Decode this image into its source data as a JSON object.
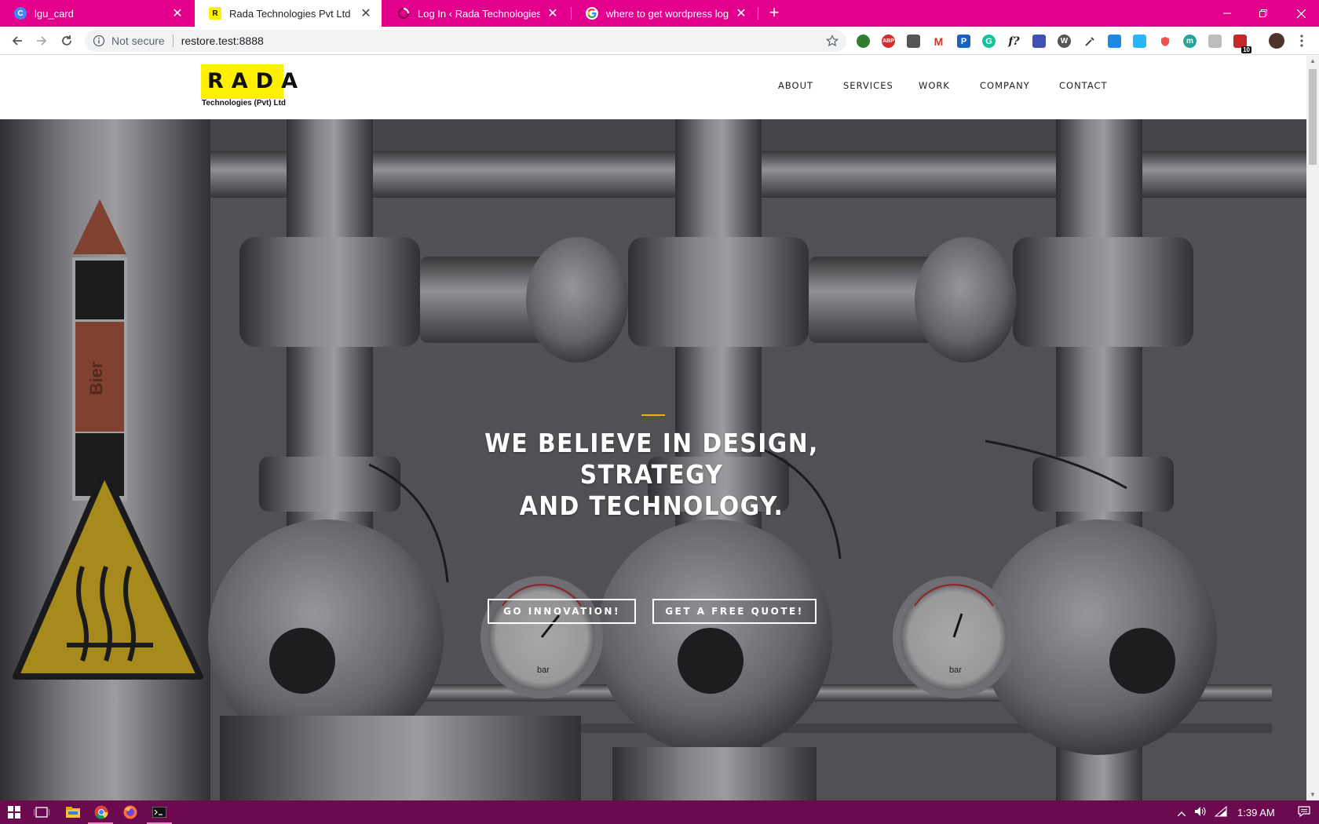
{
  "browser": {
    "tabs": [
      {
        "title": "lgu_card",
        "icon": "c-letter-icon"
      },
      {
        "title": "Rada Technologies Pvt Ltd – Auto",
        "icon": "r-letter-icon"
      },
      {
        "title": "Log In ‹ Rada Technologies Pvt Lt",
        "icon": "loading-icon"
      },
      {
        "title": "where to get wordpress login pa",
        "icon": "google-icon"
      }
    ],
    "security_label": "Not secure",
    "url": "restore.test:8888",
    "extension_badge": "10"
  },
  "site": {
    "logo": {
      "word": "RADA",
      "subtitle": "Technologies (Pvt) Ltd"
    },
    "nav": [
      "ABOUT",
      "SERVICES",
      "WORK",
      "COMPANY",
      "CONTACT"
    ],
    "hero": {
      "title_line1": "WE BELIEVE IN DESIGN, STRATEGY",
      "title_line2": "AND TECHNOLOGY.",
      "btn_primary": "GO INNOVATION!",
      "btn_secondary": "GET A FREE QUOTE!",
      "photo_sign_text": "Bier",
      "gauge_unit": "bar"
    }
  },
  "taskbar": {
    "time": "1:39 AM"
  },
  "colors": {
    "tab_strip": "#e3008c",
    "logo_bg": "#ffef00",
    "accent_line": "#e5b800",
    "taskbar": "#6b0a4e"
  }
}
